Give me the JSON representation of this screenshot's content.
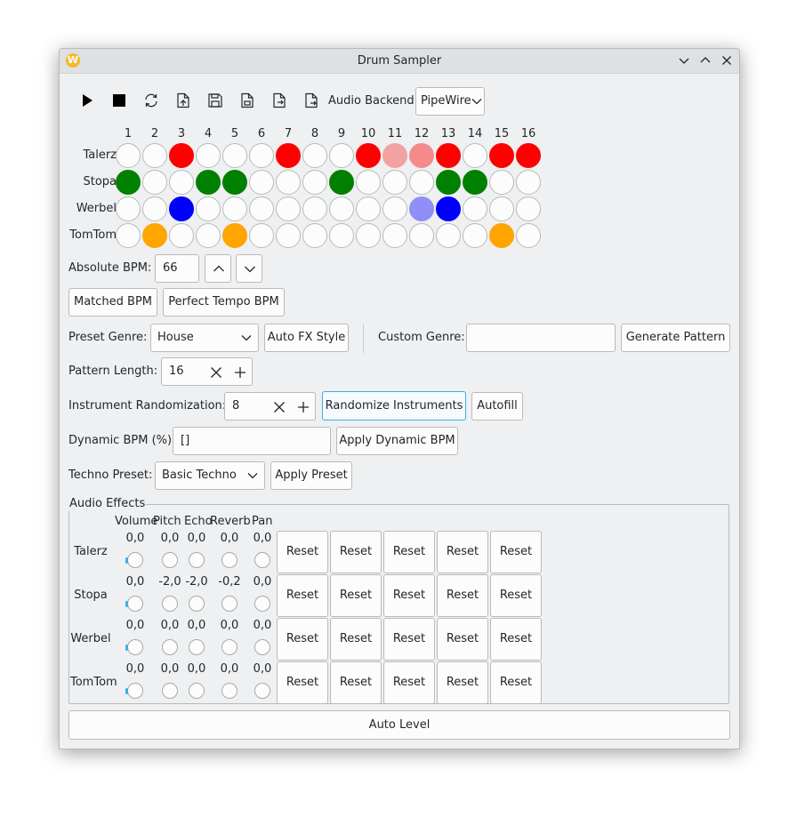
{
  "window": {
    "title": "Drum Sampler",
    "logo_letter": "W"
  },
  "toolbar": {
    "icons": [
      "play-icon",
      "stop-icon",
      "loop-icon",
      "load-pattern-icon",
      "save-icon",
      "export-icon",
      "import-icon",
      "export-midi-icon"
    ],
    "audio_backend_label": "Audio Backend:",
    "audio_backend_value": "PipeWire"
  },
  "sequencer": {
    "step_numbers": [
      "1",
      "2",
      "3",
      "4",
      "5",
      "6",
      "7",
      "8",
      "9",
      "10",
      "11",
      "12",
      "13",
      "14",
      "15",
      "16"
    ],
    "tracks": [
      {
        "name": "Talerz",
        "steps": [
          "",
          "",
          "#ff0000",
          "",
          "",
          "",
          "#ff0000",
          "",
          "",
          "#ff0000",
          "#f2a2a2",
          "#f38b8b",
          "#ff0000",
          "",
          "#ff0000",
          "#ff0000"
        ]
      },
      {
        "name": "Stopa",
        "steps": [
          "#008000",
          "",
          "",
          "#008000",
          "#008000",
          "",
          "",
          "",
          "#008000",
          "",
          "",
          "",
          "#008000",
          "#008000",
          "",
          ""
        ]
      },
      {
        "name": "Werbel",
        "steps": [
          "",
          "",
          "#0000ff",
          "",
          "",
          "",
          "",
          "",
          "",
          "",
          "",
          "#8f8ff7",
          "#0000ff",
          "",
          "",
          ""
        ]
      },
      {
        "name": "TomTom",
        "steps": [
          "",
          "#ffa500",
          "",
          "",
          "#ffa500",
          "",
          "",
          "",
          "",
          "",
          "",
          "",
          "",
          "",
          "#ffa500",
          ""
        ]
      }
    ]
  },
  "bpm": {
    "label": "Absolute BPM:",
    "value": "66"
  },
  "buttons": {
    "matched_bpm": "Matched BPM",
    "perfect_tempo_bpm": "Perfect Tempo BPM",
    "auto_fx_style": "Auto FX Style",
    "generate_pattern": "Generate Pattern",
    "randomize_instruments": "Randomize Instruments",
    "autofill": "Autofill",
    "apply_dynamic_bpm": "Apply Dynamic BPM",
    "apply_preset": "Apply Preset",
    "auto_level": "Auto Level"
  },
  "preset_genre": {
    "label": "Preset Genre:",
    "value": "House"
  },
  "custom_genre": {
    "label": "Custom Genre:",
    "value": ""
  },
  "pattern_length": {
    "label": "Pattern Length:",
    "value": "16"
  },
  "instrument_randomization": {
    "label": "Instrument Randomization:",
    "value": "8"
  },
  "dynamic_bpm": {
    "label": "Dynamic BPM (%):",
    "value": "[]"
  },
  "techno_preset": {
    "label": "Techno Preset:",
    "value": "Basic Techno"
  },
  "audio_effects": {
    "title": "Audio Effects",
    "columns": [
      "Volume",
      "Pitch",
      "Echo",
      "Reverb",
      "Pan"
    ],
    "reset_label": "Reset",
    "rows": [
      {
        "name": "Talerz",
        "values": [
          "0,0",
          "0,0",
          "0,0",
          "0,0",
          "0,0"
        ]
      },
      {
        "name": "Stopa",
        "values": [
          "0,0",
          "-2,0",
          "-2,0",
          "-0,2",
          "0,0"
        ]
      },
      {
        "name": "Werbel",
        "values": [
          "0,0",
          "0,0",
          "0,0",
          "0,0",
          "0,0"
        ]
      },
      {
        "name": "TomTom",
        "values": [
          "0,0",
          "0,0",
          "0,0",
          "0,0",
          "0,0"
        ]
      }
    ]
  },
  "colors": {
    "accent": "#3daee9",
    "window_bg": "#eff0f1",
    "titlebar_bg": "#dee0e2"
  }
}
